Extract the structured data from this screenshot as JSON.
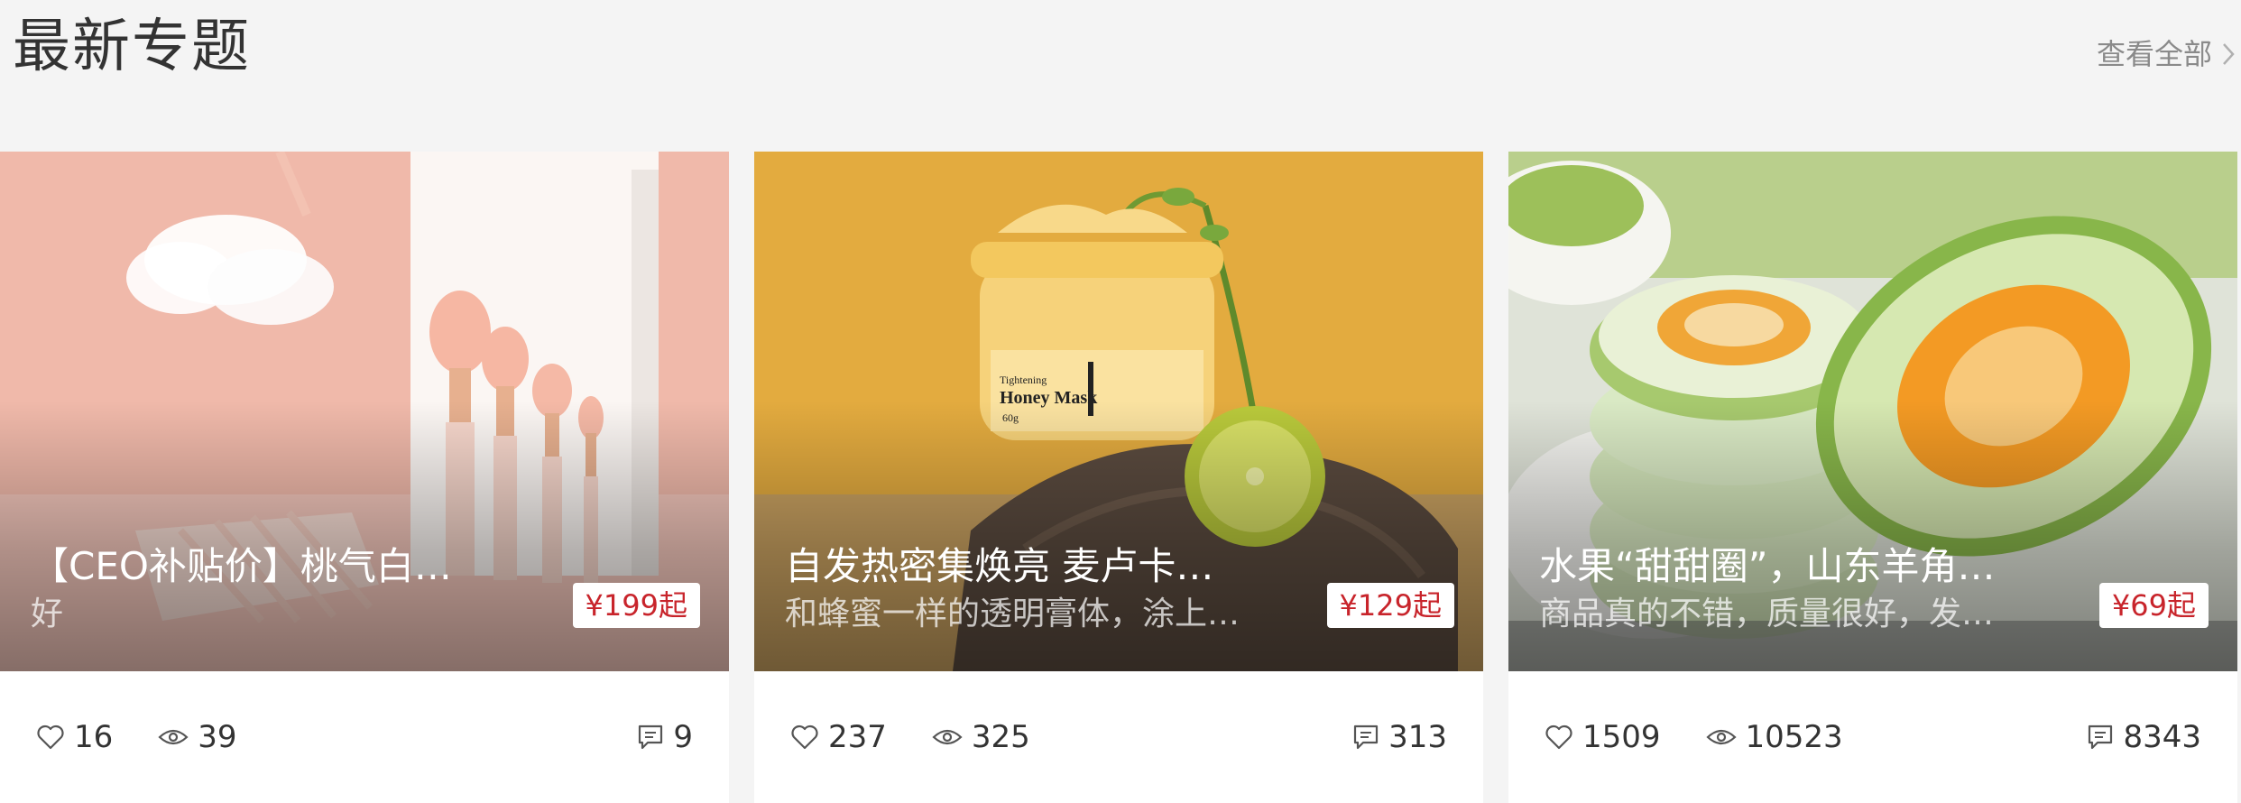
{
  "section": {
    "title": "最新专题",
    "view_all": "查看全部"
  },
  "cards": [
    {
      "title": "【CEO补贴价】桃气白…",
      "desc": "好",
      "price": "¥199起",
      "likes": "16",
      "views": "39",
      "comments": "9"
    },
    {
      "title": "自发热密集焕亮 麦卢卡…",
      "desc": "和蜂蜜一样的透明膏体，涂上…",
      "price": "¥129起",
      "likes": "237",
      "views": "325",
      "comments": "313",
      "product_label": {
        "line1": "Tightening",
        "line2": "Honey Mask",
        "line3": "60g"
      }
    },
    {
      "title": "水果“甜甜圈”，山东羊角…",
      "desc": "商品真的不错，质量很好，发…",
      "price": "¥69起",
      "likes": "1509",
      "views": "10523",
      "comments": "8343"
    }
  ],
  "colors": {
    "page_bg": "#f4f4f4",
    "price_red": "#c8242b",
    "muted_text": "#8a8a8a"
  },
  "icons": {
    "like": "heart-icon",
    "views": "eye-icon",
    "comments": "comment-icon",
    "view_all": "chevron-right-icon"
  }
}
